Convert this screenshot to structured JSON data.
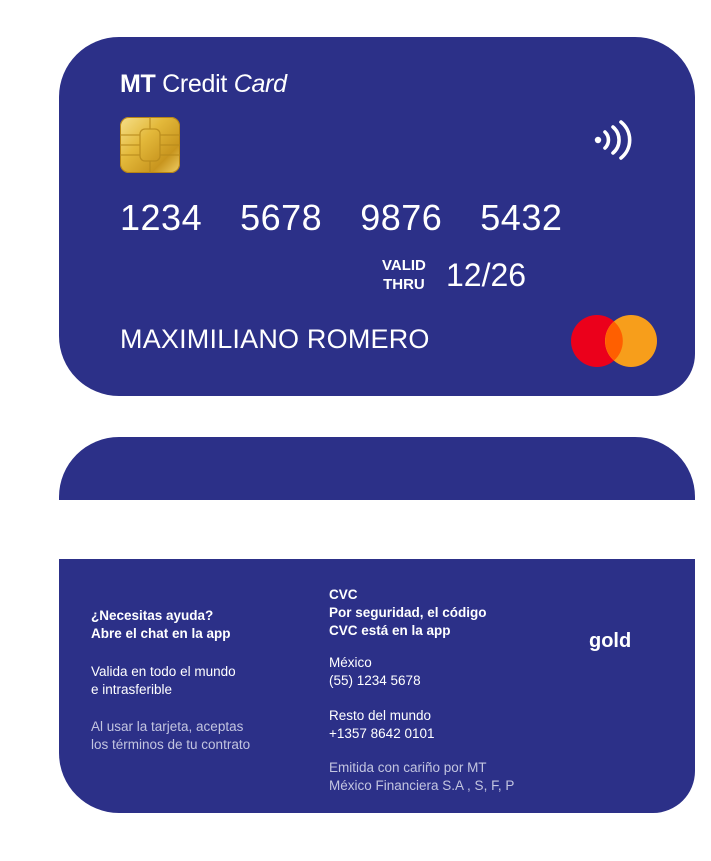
{
  "front": {
    "brand_bold": "MT",
    "brand_regular": "Credit",
    "brand_italic": "Card",
    "number_groups": [
      "1234",
      "5678",
      "9876",
      "5432"
    ],
    "valid_line1": "VALID",
    "valid_line2": "THRU",
    "expiry": "12/26",
    "holder_name": "MAXIMILIANO ROMERO",
    "card_color": "#2c3088"
  },
  "back": {
    "help_line1": "¿Necesitas ayuda?",
    "help_line2": "Abre el chat en la app",
    "valid_line1": "Valida en todo el mundo",
    "valid_line2": "e intrasferible",
    "terms_line1": "Al usar la tarjeta, aceptas",
    "terms_line2": "los términos de tu contrato",
    "cvc_title": "CVC",
    "cvc_line1": "Por seguridad, el código",
    "cvc_line2": "CVC está en la app",
    "mexico_label": "México",
    "mexico_phone": "(55) 1234  5678",
    "world_label": "Resto del mundo",
    "world_phone": "+1357  8642  0101",
    "issuer_line1": "Emitida con cariño por MT",
    "issuer_line2": "México Financiera S.A , S, F, P",
    "tier": "gold"
  }
}
